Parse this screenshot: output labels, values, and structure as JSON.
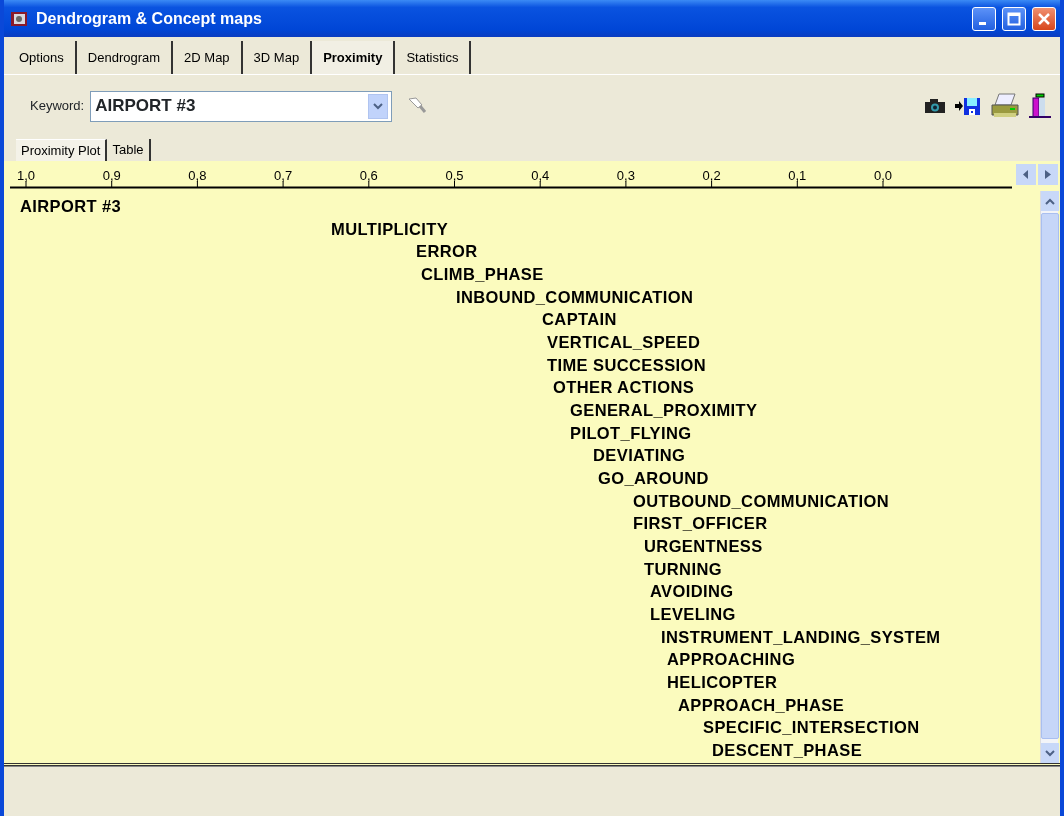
{
  "window": {
    "title": "Dendrogram & Concept maps"
  },
  "tabs": [
    {
      "label": "Options",
      "selected": false
    },
    {
      "label": "Dendrogram",
      "selected": false
    },
    {
      "label": "2D Map",
      "selected": false
    },
    {
      "label": "3D Map",
      "selected": false
    },
    {
      "label": "Proximity",
      "selected": true
    },
    {
      "label": "Statistics",
      "selected": false
    }
  ],
  "keyword": {
    "label": "Keyword:",
    "value": "AIRPORT #3"
  },
  "subtabs": [
    {
      "label": "Proximity Plot",
      "selected": true
    },
    {
      "label": "Table",
      "selected": false
    }
  ],
  "plot": {
    "axis_ticks": [
      "1,0",
      "0,9",
      "0,8",
      "0,7",
      "0,6",
      "0,5",
      "0,4",
      "0,3",
      "0,2",
      "0,1",
      "0,0"
    ],
    "terms": [
      "AIRPORT #3",
      "MULTIPLICITY",
      "ERROR",
      "CLIMB_PHASE",
      "INBOUND_COMMUNICATION",
      "CAPTAIN",
      "VERTICAL_SPEED",
      "TIME SUCCESSION",
      "OTHER ACTIONS",
      "GENERAL_PROXIMITY",
      "PILOT_FLYING",
      "DEVIATING",
      "GO_AROUND",
      "OUTBOUND_COMMUNICATION",
      "FIRST_OFFICER",
      "URGENTNESS",
      "TURNING",
      "AVOIDING",
      "LEVELING",
      "INSTRUMENT_LANDING_SYSTEM",
      "APPROACHING",
      "HELICOPTER",
      "APPROACH_PHASE",
      "SPECIFIC_INTERSECTION",
      "DESCENT_PHASE"
    ]
  }
}
